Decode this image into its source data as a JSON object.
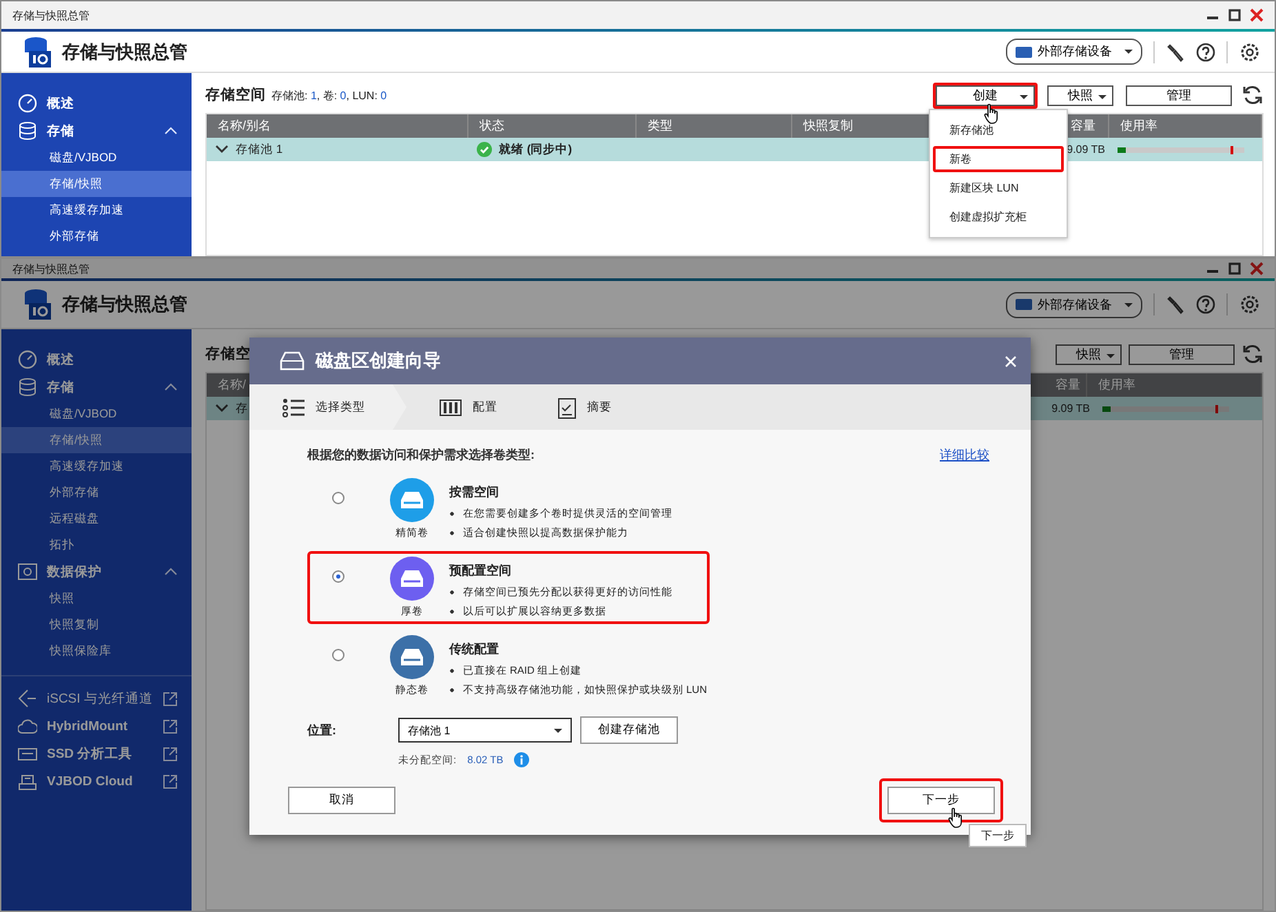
{
  "top": {
    "window_title": "存储与快照总管",
    "app_title": "存储与快照总管",
    "external_button": "外部存储设备",
    "sidebar": [
      {
        "label": "概述",
        "kind": "overview",
        "selected": false
      },
      {
        "label": "存储",
        "kind": "storage",
        "selected": false,
        "expanded": true,
        "children": [
          {
            "label": "磁盘/VJBOD",
            "selected": false
          },
          {
            "label": "存储/快照",
            "selected": true
          },
          {
            "label": "高速缓存加速",
            "selected": false
          },
          {
            "label": "外部存储",
            "selected": false
          }
        ]
      }
    ],
    "heading": "存储空间",
    "summary": [
      {
        "label": "存储池:",
        "value": "1"
      },
      {
        "label": ", 卷:",
        "value": "0"
      },
      {
        "label": ", LUN:",
        "value": "0"
      }
    ],
    "toolbar": [
      {
        "label": "创建",
        "dropdown": true,
        "highlighted": true
      },
      {
        "label": "快照",
        "dropdown": true,
        "highlighted": false
      },
      {
        "label": "管理",
        "dropdown": false,
        "highlighted": false
      }
    ],
    "columns": [
      "名称/别名",
      "状态",
      "类型",
      "快照复制",
      "容量",
      "使用率"
    ],
    "rows": [
      {
        "name": "存储池 1",
        "expanded": true,
        "status": "就绪 (同步中)",
        "capacity": "9.09 TB",
        "level": 0.07
      }
    ],
    "menu": [
      {
        "label": "新存储池",
        "highlighted": false
      },
      {
        "label": "新卷",
        "highlighted": true
      },
      {
        "label": "新建区块 LUN",
        "highlighted": false
      },
      {
        "label": "创建虚拟扩充柜",
        "highlighted": false
      }
    ]
  },
  "bottom": {
    "window_title": "存储与快照总管",
    "app_title": "存储与快照总管",
    "external_button": "外部存储设备",
    "sidebar": [
      {
        "label": "概述",
        "kind": "overview",
        "selected": false
      },
      {
        "label": "存储",
        "kind": "storage",
        "selected": false,
        "expanded": true,
        "children": [
          {
            "label": "磁盘/VJBOD",
            "selected": false
          },
          {
            "label": "存储/快照",
            "selected": true
          },
          {
            "label": "高速缓存加速",
            "selected": false
          },
          {
            "label": "外部存储",
            "selected": false
          },
          {
            "label": "远程磁盘",
            "selected": false
          },
          {
            "label": "拓扑",
            "selected": false
          }
        ]
      },
      {
        "label": "数据保护",
        "kind": "protection",
        "selected": false,
        "expanded": true,
        "children": [
          {
            "label": "快照",
            "selected": false
          },
          {
            "label": "快照复制",
            "selected": false
          },
          {
            "label": "快照保险库",
            "selected": false
          }
        ]
      },
      {
        "label": "iSCSI 与光纤通道",
        "kind": "iscsi",
        "selected": false
      },
      {
        "label": "HybridMount",
        "kind": "mount",
        "selected": false
      },
      {
        "label": "SSD 分析工具",
        "kind": "ssd",
        "selected": false
      },
      {
        "label": "VJBOD Cloud",
        "kind": "cloud",
        "selected": false
      }
    ],
    "heading": "存储空",
    "toolbar": [
      {
        "label": "快照",
        "dropdown": true
      },
      {
        "label": "管理",
        "dropdown": false
      }
    ],
    "columns": [
      "名称/",
      "容量",
      "使用率"
    ],
    "rows": [
      {
        "name": "存",
        "expanded": true,
        "capacity": "9.09 TB",
        "level": 0.07
      }
    ],
    "wizard": {
      "title": "磁盘区创建向导",
      "steps": [
        {
          "label": "选择类型",
          "kind": "list",
          "selected": true
        },
        {
          "label": "配置",
          "kind": "config",
          "selected": false
        },
        {
          "label": "摘要",
          "kind": "summary",
          "selected": false
        }
      ],
      "intro": "根据您的数据访问和保护需求选择卷类型:",
      "compare_link": "详细比较",
      "options": [
        {
          "kind": "thin",
          "icon_label": "精简卷",
          "title": "按需空间",
          "bullets": [
            "在您需要创建多个卷时提供灵活的空间管理",
            "适合创建快照以提高数据保护能力"
          ],
          "selected": false,
          "highlighted": false
        },
        {
          "kind": "thick",
          "icon_label": "厚卷",
          "title": "预配置空间",
          "bullets": [
            "存储空间已预先分配以获得更好的访问性能",
            "以后可以扩展以容纳更多数据"
          ],
          "selected": true,
          "highlighted": true
        },
        {
          "kind": "static",
          "icon_label": "静态卷",
          "title": "传统配置",
          "bullets": [
            "已直接在 RAID 组上创建",
            "不支持高级存储池功能，如快照保护或块级别 LUN"
          ],
          "selected": false,
          "highlighted": false
        }
      ],
      "location_label": "位置:",
      "location_value": "存储池 1",
      "create_pool": "创建存储池",
      "unallocated_label": "未分配空间:",
      "unallocated_value": "8.02 TB",
      "cancel": "取消",
      "next": {
        "label": "下一步",
        "highlighted": true
      },
      "tooltip": "下一步"
    }
  }
}
